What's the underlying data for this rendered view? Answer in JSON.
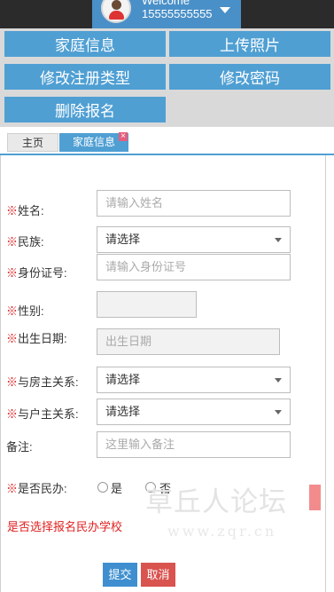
{
  "header": {
    "welcome": "Welcome",
    "phone": "15555555555"
  },
  "menu": {
    "family_info": "家庭信息",
    "upload_photo": "上传照片",
    "modify_type": "修改注册类型",
    "modify_password": "修改密码",
    "delete_registration": "删除报名"
  },
  "tabs": {
    "home": "主页",
    "family": "家庭信息",
    "close": "×"
  },
  "form": {
    "name_label": "姓名:",
    "name_placeholder": "请输入姓名",
    "ethnicity_label": "民族:",
    "ethnicity_value": "请选择",
    "id_label": "身份证号:",
    "id_placeholder": "请输入身份证号",
    "gender_label": "性别:",
    "birth_label": "出生日期:",
    "birth_placeholder": "出生日期",
    "house_relation_label": "与房主关系:",
    "house_relation_value": "请选择",
    "household_relation_label": "与户主关系:",
    "household_relation_value": "请选择",
    "remark_label": "备注:",
    "remark_placeholder": "这里输入备注",
    "private_label": "是否民办:",
    "yes": "是",
    "no": "否",
    "required_mark": "※",
    "hint": "是否选择报名民办学校",
    "submit": "提交",
    "cancel": "取消"
  },
  "watermark": {
    "text": "草丘人论坛",
    "url": "www.zqr.cn"
  }
}
